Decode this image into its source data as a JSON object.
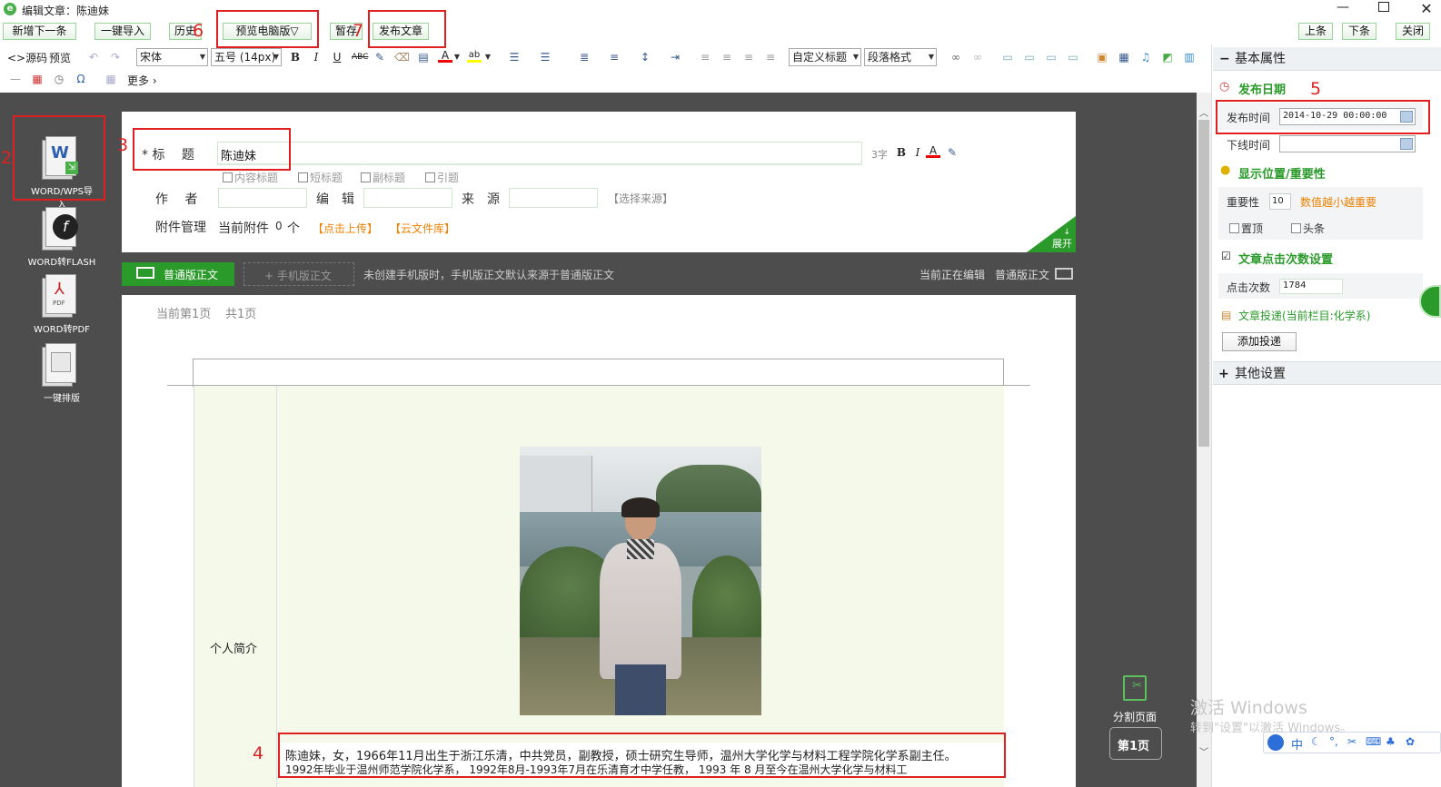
{
  "window": {
    "title": "编辑文章：陈迪妹"
  },
  "toolbar": {
    "new_next": "新增下一条",
    "import": "一键导入",
    "history": "历史",
    "preview_pc": "预览电脑版▽",
    "save_draft": "暂存",
    "publish": "发布文章",
    "prev": "上条",
    "next": "下条",
    "close": "关闭"
  },
  "editor_toolbar": {
    "source": "<>源码",
    "preview": "预览",
    "font_family": "宋体",
    "font_size": "五号 (14px)",
    "custom_heading": "自定义标题",
    "paragraph_format": "段落格式",
    "more": "更多 ›"
  },
  "left_tools": [
    {
      "label": "WORD/WPS导入"
    },
    {
      "label": "WORD转FLASH"
    },
    {
      "label": "WORD转PDF"
    },
    {
      "label": "一键排版"
    }
  ],
  "article_form": {
    "title_label": "* 标　 题",
    "title_value": "陈迪妹",
    "char_count": "3字",
    "options": [
      "内容标题",
      "短标题",
      "副标题",
      "引题"
    ],
    "author_label": "作　 者",
    "editor_label": "编　辑",
    "source_label": "来　源",
    "select_source": "【选择来源】",
    "attachment_label": "附件管理",
    "attachment_current": "当前附件",
    "attachment_count": "0",
    "attachment_unit": "个",
    "upload": "【点击上传】",
    "cloud": "【云文件库】",
    "expand": "展开"
  },
  "content_tabs": {
    "normal": "普通版正文",
    "mobile": "+ 手机版正文",
    "hint": "未创建手机版时，手机版正文默认来源于普通版正文",
    "editing_prefix": "当前正在编辑",
    "editing_value": "普通版正文"
  },
  "document": {
    "page_info": "当前第1页",
    "page_total": "共1页",
    "cell_label": "个人简介",
    "bio_line1": "陈迪妹，女，1966年11月出生于浙江乐清，中共党员，副教授，硕士研究生导师，温州大学化学与材料工程学院化学系副主任。",
    "bio_line2": "1992年毕业于温州师范学院化学系， 1992年8月-1993年7月在乐清育才中学任教， 1993 年 8 月至今在温州大学化学与材料工"
  },
  "page_split": {
    "label": "分割页面",
    "page": "第1页"
  },
  "right_panel": {
    "basic_props": "基本属性",
    "publish_date_heading": "发布日期",
    "publish_time_label": "发布时间",
    "publish_time_value": "2014-10-29 00:00:00",
    "offline_time_label": "下线时间",
    "offline_time_value": "",
    "position_heading": "显示位置/重要性",
    "importance_label": "重要性",
    "importance_value": "10",
    "importance_hint": "数值越小越重要",
    "pin_top": "置顶",
    "headline": "头条",
    "clicks_heading": "文章点击次数设置",
    "clicks_label": "点击次数",
    "clicks_value": "1784",
    "delivery": "文章投递(当前栏目:化学系)",
    "add_delivery": "添加投递",
    "other_settings": "其他设置"
  },
  "watermark": {
    "line1": "激活 Windows",
    "line2": "转到\"设置\"以激活 Windows。"
  },
  "annotations": [
    "2",
    "3",
    "4",
    "5",
    "6",
    "7"
  ],
  "colors": {
    "accent_green": "#2a9a2a",
    "dark_bg": "#4d4d4d",
    "annotation_red": "#e02020",
    "orange_link": "#f08000"
  }
}
